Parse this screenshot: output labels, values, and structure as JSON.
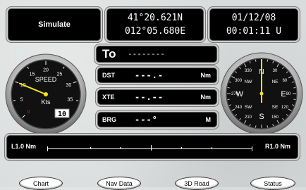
{
  "simulate_label": "Simulate",
  "position": {
    "lat": "41°20.621N",
    "lon": "012°05.680E"
  },
  "datetime": {
    "date": "01/12/08",
    "time": "00:01:11 U"
  },
  "to": {
    "label": "To",
    "value": "--------"
  },
  "speed_gauge": {
    "title": "SPEED",
    "unit": "Kts",
    "value": "10",
    "ticks": [
      "5",
      "10",
      "15",
      "20",
      "25",
      "30",
      "35",
      "40"
    ],
    "scale_zero": "0",
    "needle_value": 10
  },
  "fields": [
    {
      "label": "DST",
      "value": "---.-",
      "unit": "Nm"
    },
    {
      "label": "XTE",
      "value": "--.--",
      "unit": "Nm"
    },
    {
      "label": "BRG",
      "value": "---°",
      "unit": "M"
    }
  ],
  "compass": {
    "cardinals": {
      "n": "N",
      "e": "E",
      "s": "S",
      "w": "W"
    },
    "intercardinals": {
      "ne": "NE",
      "se": "SE",
      "sw": "SW",
      "nw": "NW"
    },
    "degrees": [
      "30",
      "60",
      "90",
      "120",
      "150",
      "210",
      "240",
      "270",
      "300",
      "330"
    ],
    "heading_deg": 0
  },
  "xte_bar": {
    "left_label": "L1.0 Nm",
    "right_label": "R1.0 Nm"
  },
  "buttons": {
    "chart": "Chart",
    "nav_data": "Nav Data",
    "road_3d": "3D Road",
    "status": "Status"
  },
  "colors": {
    "panel": "#000000",
    "needle": "#f5e21a",
    "gauge_face": "#111111",
    "accent_red": "#d02020"
  }
}
